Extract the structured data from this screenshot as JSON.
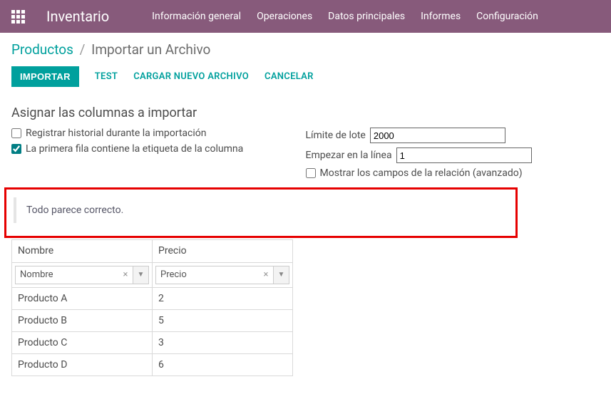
{
  "topbar": {
    "app_title": "Inventario",
    "nav": [
      "Información general",
      "Operaciones",
      "Datos principales",
      "Informes",
      "Configuración"
    ]
  },
  "breadcrumb": {
    "link": "Productos",
    "sep": "/",
    "current": "Importar un Archivo"
  },
  "toolbar": {
    "importar": "IMPORTAR",
    "test": "TEST",
    "cargar": "CARGAR NUEVO ARCHIVO",
    "cancelar": "CANCELAR"
  },
  "section_title": "Asignar las columnas a importar",
  "options": {
    "track_label": "Registrar historial durante la importación",
    "track_checked": false,
    "firstrow_label": "La primera fila contiene la etiqueta de la columna",
    "firstrow_checked": true,
    "lot_label": "Límite de lote",
    "lot_value": "2000",
    "start_label": "Empezar en la línea",
    "start_value": "1",
    "showrel_label": "Mostrar los campos de la relación (avanzado)",
    "showrel_checked": false
  },
  "status_msg": "Todo parece correcto.",
  "table": {
    "headers": [
      "Nombre",
      "Precio"
    ],
    "mapping": [
      "Nombre",
      "Precio"
    ],
    "rows": [
      [
        "Producto A",
        "2"
      ],
      [
        "Producto B",
        "5"
      ],
      [
        "Producto C",
        "3"
      ],
      [
        "Producto D",
        "6"
      ]
    ]
  }
}
